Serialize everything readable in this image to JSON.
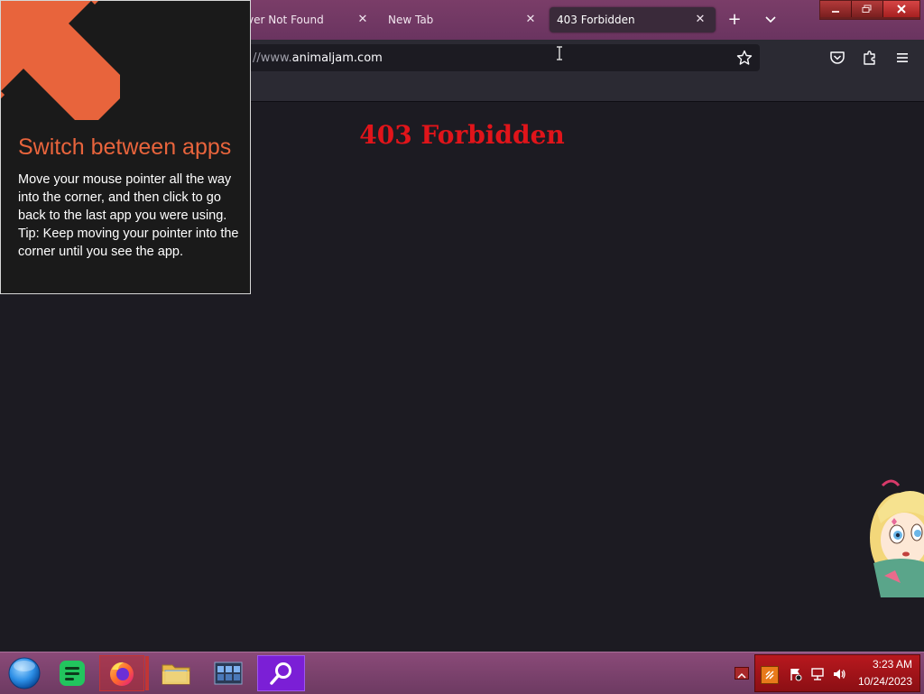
{
  "browser": {
    "tabs": [
      {
        "label": "ver Not Found",
        "active": false
      },
      {
        "label": "New Tab",
        "active": false
      },
      {
        "label": "403 Forbidden",
        "active": true
      }
    ],
    "url_prefix": "//www.",
    "url_domain": "animaljam.com"
  },
  "page": {
    "heading": "403 Forbidden",
    "heading_color": "#e0141a"
  },
  "tip": {
    "title": "Switch between apps",
    "body_line1": "Move your mouse pointer all the way into the corner, and then click to go back to the last app you were using.",
    "body_line2": "Tip: Keep moving your pointer into the corner until you see the app.",
    "accent_color": "#e8643c"
  },
  "taskbar": {
    "apps": [
      "start-orb",
      "notes-app",
      "firefox",
      "file-explorer",
      "window-switcher",
      "search-app"
    ],
    "clock_time": "3:23 AM",
    "clock_date": "10/24/2023"
  },
  "colors": {
    "tabstrip": "#6a3460",
    "taskbar": "#6d3a62",
    "tray": "#b8181e"
  }
}
